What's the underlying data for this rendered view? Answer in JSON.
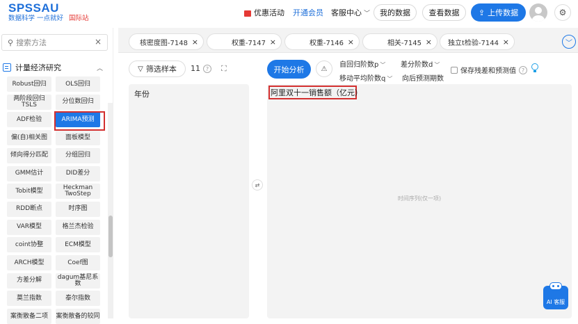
{
  "header": {
    "logo_main": "SPSSAU",
    "logo_sub": "数据科学 一点就好",
    "logo_intl": "国际站",
    "promo_label": "优惠活动",
    "vip_label": "开通会员",
    "service_label": "客服中心",
    "my_data_label": "我的数据",
    "view_data_label": "查看数据",
    "upload_label": "上传数据"
  },
  "sidebar": {
    "search_placeholder": "搜索方法",
    "category_label": "计量经济研究",
    "methods": [
      "Robust回归",
      "OLS回归",
      "两阶段回归\nTSLS",
      "分位数回归",
      "ADF检验",
      "ARIMA预测",
      "偏(自)相关图",
      "面板模型",
      "倾向得分匹配",
      "分组回归",
      "GMM估计",
      "DID差分",
      "Tobit模型",
      "Heckman\nTwoStep",
      "RDD断点",
      "时序图",
      "VAR模型",
      "格兰杰检验",
      "coint协整",
      "ECM模型",
      "ARCH模型",
      "Coef图",
      "方差分解",
      "dagum基尼系\n数",
      "莫兰指数",
      "泰尔指数",
      "案衡散备二项",
      "案衡散备的较同"
    ],
    "active_method": "ARIMA预测"
  },
  "tabs": [
    {
      "label": "核密度图-7148"
    },
    {
      "label": "权重-7147"
    },
    {
      "label": "权重-7146"
    },
    {
      "label": "相关-7145"
    },
    {
      "label": "独立t检验-7144"
    }
  ],
  "toolbar": {
    "filter_label": "筛选样本",
    "sample_count": "11",
    "start_label": "开始分析",
    "ar_order_label": "自回归阶数p",
    "diff_order_label": "差分阶数d",
    "ma_order_label": "移动平均阶数q",
    "forecast_periods_label": "向后预测期数",
    "save_label": "保存残差和预测值"
  },
  "panels": {
    "left_title": "年份",
    "selected_variable": "阿里双十一销售额（亿元）",
    "drop_hint": "时间序列(仅一项)"
  },
  "ai": {
    "label": "AI 客服"
  },
  "colors": {
    "brand_blue": "#1e78e6",
    "highlight_red": "#d32f2f",
    "intl_red": "#e53935"
  }
}
